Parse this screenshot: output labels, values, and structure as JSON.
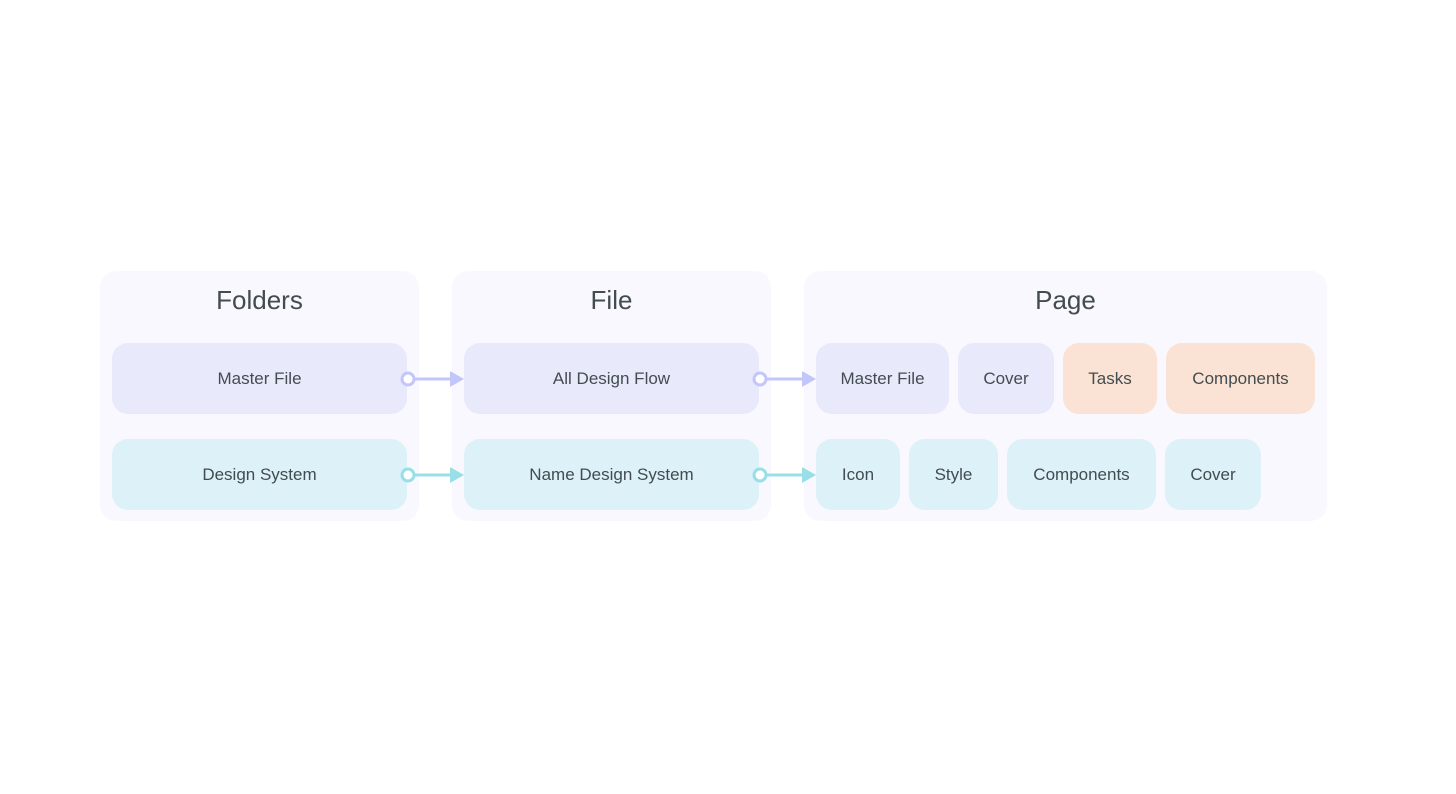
{
  "columns": {
    "folders": "Folders",
    "file": "File",
    "page": "Page"
  },
  "folders": [
    "Master File",
    "Design System"
  ],
  "files": [
    "All Design Flow",
    "Name Design System"
  ],
  "pages_row1": [
    "Master File",
    "Cover",
    "Tasks",
    "Components"
  ],
  "pages_row2": [
    "Icon",
    "Style",
    "Components",
    "Cover"
  ],
  "colors": {
    "panel": "#f9f8fe",
    "purple": "#e9e9fc",
    "cyan": "#dcf1f8",
    "orange": "#fae3d4",
    "arrow_purple": "#c3c6fa",
    "arrow_cyan": "#98dfe8"
  }
}
